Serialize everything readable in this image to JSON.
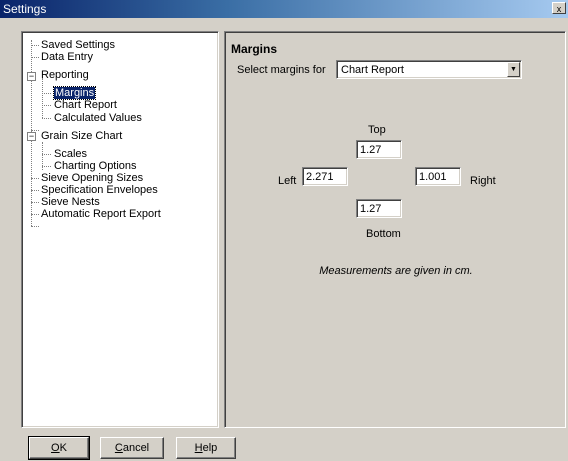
{
  "window": {
    "title": "Settings",
    "close_glyph": "x"
  },
  "tree": {
    "items": [
      {
        "label": "Saved Settings"
      },
      {
        "label": "Data Entry"
      },
      {
        "label": "Reporting",
        "expander": "−"
      },
      {
        "label": "Margins",
        "selected": true
      },
      {
        "label": "Chart Report"
      },
      {
        "label": "Calculated Values"
      },
      {
        "label": "Grain Size Chart",
        "expander": "−"
      },
      {
        "label": "Scales"
      },
      {
        "label": "Charting Options"
      },
      {
        "label": "Sieve Opening Sizes"
      },
      {
        "label": "Specification Envelopes"
      },
      {
        "label": "Sieve Nests"
      },
      {
        "label": "Automatic Report Export"
      }
    ]
  },
  "panel": {
    "heading": "Margins",
    "select_label": "Select margins for",
    "select_value": "Chart Report",
    "top_label": "Top",
    "top_value": "1.27",
    "left_label": "Left",
    "left_value": "2.271",
    "right_label": "Right",
    "right_value": "1.001",
    "bottom_label": "Bottom",
    "bottom_value": "1.27",
    "note": "Measurements are given in cm."
  },
  "buttons": {
    "ok": {
      "mnemonic": "O",
      "rest": "K"
    },
    "cancel": {
      "mnemonic": "C",
      "rest": "ancel"
    },
    "help": {
      "mnemonic": "H",
      "rest": "elp"
    }
  }
}
